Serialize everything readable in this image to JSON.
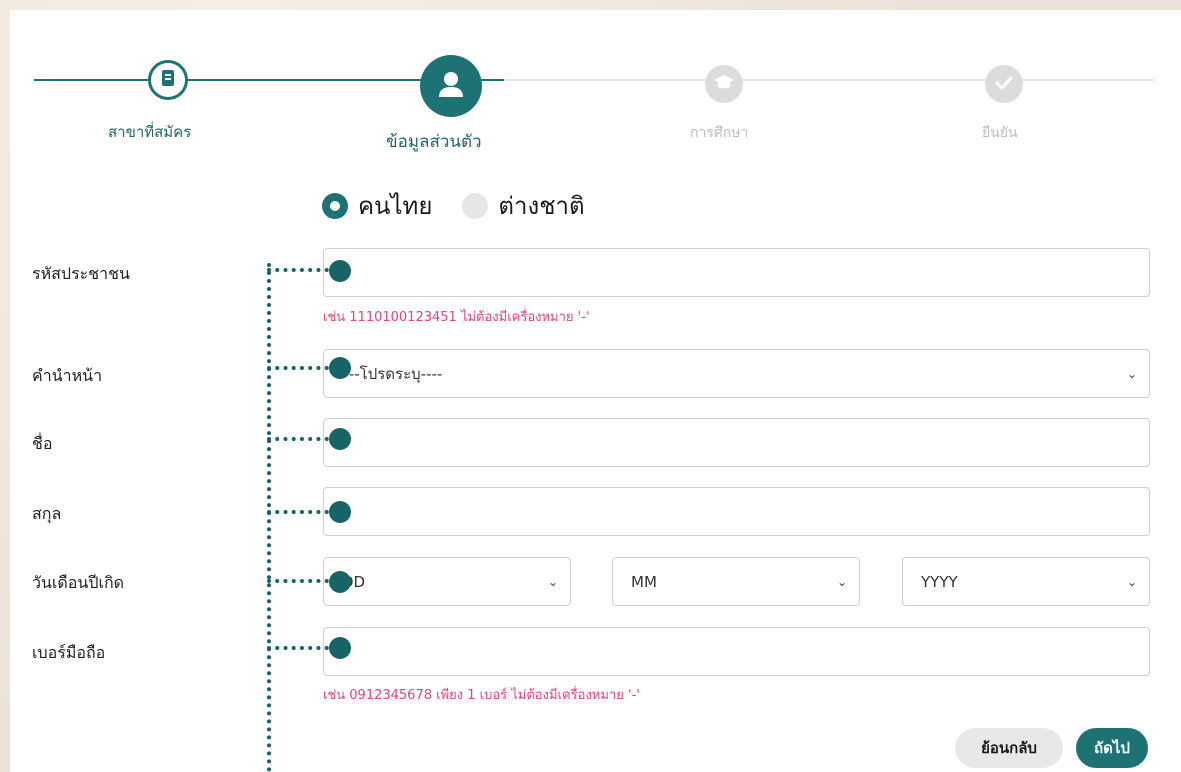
{
  "stepper": {
    "steps": [
      {
        "label": "สาขาที่สมัคร",
        "icon": "book-icon",
        "state": "completed"
      },
      {
        "label": "ข้อมูลส่วนตัว",
        "icon": "user-icon",
        "state": "active"
      },
      {
        "label": "การศึกษา",
        "icon": "graduation-cap-icon",
        "state": "pending"
      },
      {
        "label": "ยืนยัน",
        "icon": "check-icon",
        "state": "pending"
      }
    ]
  },
  "nationality": {
    "options": [
      "คนไทย",
      "ต่างชาติ"
    ],
    "selected": "คนไทย"
  },
  "form": {
    "id_label": "รหัสประชาชน",
    "id_value": "",
    "id_hint": "เช่น 1110100123451 ไม่ต้องมีเครื่องหมาย '-'",
    "title_label": "คำนำหน้า",
    "title_selected": "----โปรดระบุ----",
    "firstname_label": "ชื่อ",
    "firstname_value": "",
    "lastname_label": "สกุล",
    "lastname_value": "",
    "dob_label": "วันเดือนปีเกิด",
    "dob_day": "DD",
    "dob_month": "MM",
    "dob_year": "YYYY",
    "phone_label": "เบอร์มือถือ",
    "phone_value": "",
    "phone_hint": "เช่น 0912345678 เพียง 1 เบอร์ ไม่ต้องมีเครื่องหมาย '-'"
  },
  "buttons": {
    "back_label": "ย้อนกลับ",
    "next_label": "ถัดไป"
  },
  "colors": {
    "accent": "#1d7274",
    "hint": "#e0457b",
    "inactive": "#dcdcdc"
  }
}
